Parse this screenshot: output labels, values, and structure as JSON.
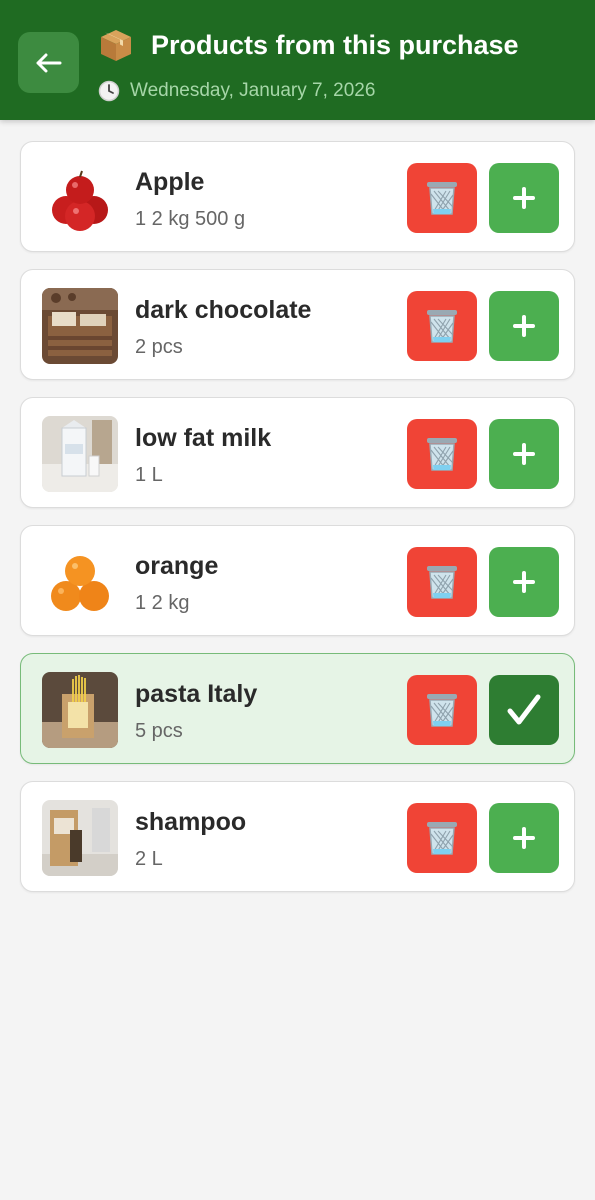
{
  "header": {
    "title_icon": "package-icon",
    "title": "Products from this purchase",
    "date_icon": "clock-icon",
    "date": "Wednesday, January 7, 2026",
    "back_icon": "arrow-left-icon",
    "color": "#1f6b22"
  },
  "products": [
    {
      "name": "Apple",
      "quantity": "1 2 kg 500 g",
      "image": "apple-image",
      "selected": false
    },
    {
      "name": "dark chocolate",
      "quantity": "2 pcs",
      "image": "chocolate-image",
      "selected": false
    },
    {
      "name": "low fat milk",
      "quantity": "1 L",
      "image": "milk-image",
      "selected": false
    },
    {
      "name": "orange",
      "quantity": "1 2 kg",
      "image": "orange-image",
      "selected": false
    },
    {
      "name": "pasta Italy",
      "quantity": "5 pcs",
      "image": "pasta-image",
      "selected": true
    },
    {
      "name": "shampoo",
      "quantity": "2 L",
      "image": "shampoo-image",
      "selected": false
    }
  ],
  "actions": {
    "delete_icon": "trash-icon",
    "add_icon": "plus-icon",
    "selected_icon": "checkmark-icon"
  },
  "colors": {
    "delete": "#f04436",
    "add": "#4caf50",
    "added": "#2e7d32",
    "selected_card": "#e6f4e6"
  }
}
